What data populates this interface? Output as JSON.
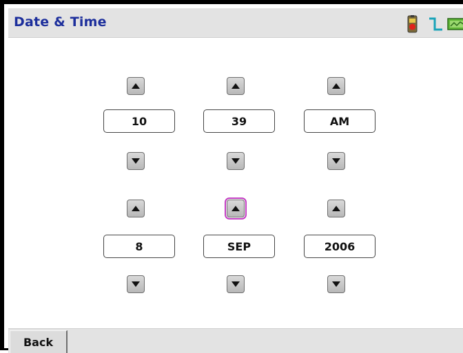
{
  "window": {
    "title": "Date & Time"
  },
  "status_icons": [
    "battery-icon",
    "signal-icon",
    "sensor-icon"
  ],
  "time": {
    "hour": "10",
    "minute": "39",
    "ampm": "AM"
  },
  "date": {
    "day": "8",
    "month": "SEP",
    "year": "2006"
  },
  "focused_control": "month-increment-button",
  "footer": {
    "back_label": "Back"
  },
  "colors": {
    "title_text": "#1d2f9c",
    "focus_outline": "#c23cc2",
    "bar_background": "#e3e3e3"
  }
}
